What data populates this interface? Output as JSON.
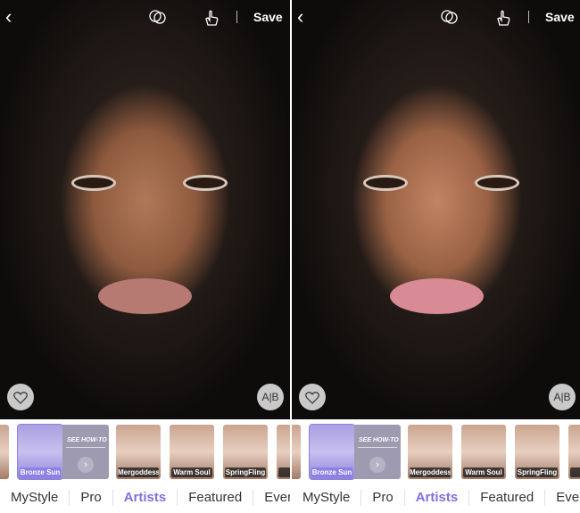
{
  "panels": [
    {
      "state": "before",
      "nav": {
        "back_icon": "chevron-left-icon",
        "compare_icon": "overlap-circles-icon",
        "touch_icon": "hand-pointer-icon",
        "save_label": "Save"
      },
      "overlay": {
        "favorite_icon": "heart-icon",
        "ab_label": "A|B"
      },
      "looks": [
        {
          "label": ""
        },
        {
          "label": "Bronze Sun",
          "selected": true
        },
        {
          "label": "Mergoddess"
        },
        {
          "label": "Warm Soul"
        },
        {
          "label": "SpringFling"
        },
        {
          "label": "M"
        }
      ],
      "howto_label": "SEE HOW-TO",
      "tabs": [
        {
          "label": "MyStyle"
        },
        {
          "label": "Pro"
        },
        {
          "label": "Artists",
          "active": true
        },
        {
          "label": "Featured"
        },
        {
          "label": "Every"
        }
      ]
    },
    {
      "state": "after",
      "nav": {
        "back_icon": "chevron-left-icon",
        "compare_icon": "overlap-circles-icon",
        "touch_icon": "hand-pointer-icon",
        "save_label": "Save"
      },
      "overlay": {
        "favorite_icon": "heart-icon",
        "ab_label": "A|B"
      },
      "looks": [
        {
          "label": ""
        },
        {
          "label": "Bronze Sun",
          "selected": true
        },
        {
          "label": "Mergoddess"
        },
        {
          "label": "Warm Soul"
        },
        {
          "label": "SpringFling"
        },
        {
          "label": "M"
        }
      ],
      "howto_label": "SEE HOW-TO",
      "tabs": [
        {
          "label": "MyStyle"
        },
        {
          "label": "Pro"
        },
        {
          "label": "Artists",
          "active": true
        },
        {
          "label": "Featured"
        },
        {
          "label": "Every"
        }
      ]
    }
  ],
  "colors": {
    "accent": "#8070e0"
  }
}
